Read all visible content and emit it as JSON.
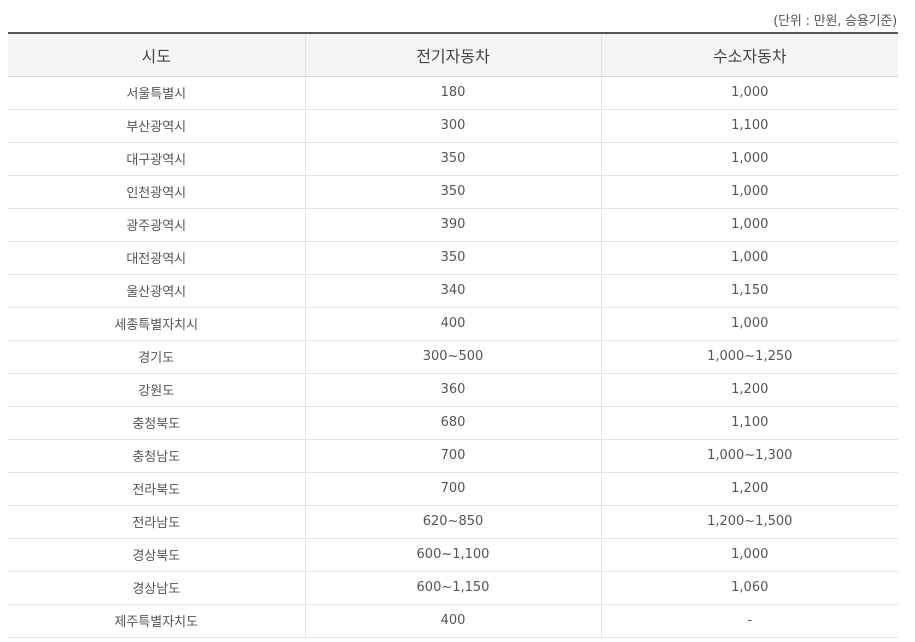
{
  "unit_note": "(단위 : 만원, 승용기준)",
  "table": {
    "headers": [
      "시도",
      "전기자동차",
      "수소자동차"
    ],
    "rows": [
      [
        "서울특별시",
        "180",
        "1,000"
      ],
      [
        "부산광역시",
        "300",
        "1,100"
      ],
      [
        "대구광역시",
        "350",
        "1,000"
      ],
      [
        "인천광역시",
        "350",
        "1,000"
      ],
      [
        "광주광역시",
        "390",
        "1,000"
      ],
      [
        "대전광역시",
        "350",
        "1,000"
      ],
      [
        "울산광역시",
        "340",
        "1,150"
      ],
      [
        "세종특별자치시",
        "400",
        "1,000"
      ],
      [
        "경기도",
        "300~500",
        "1,000~1,250"
      ],
      [
        "강원도",
        "360",
        "1,200"
      ],
      [
        "충청북도",
        "680",
        "1,100"
      ],
      [
        "충청남도",
        "700",
        "1,000~1,300"
      ],
      [
        "전라북도",
        "700",
        "1,200"
      ],
      [
        "전라남도",
        "620~850",
        "1,200~1,500"
      ],
      [
        "경상북도",
        "600~1,100",
        "1,000"
      ],
      [
        "경상남도",
        "600~1,150",
        "1,060"
      ],
      [
        "제주특별자치도",
        "400",
        "-"
      ]
    ]
  }
}
